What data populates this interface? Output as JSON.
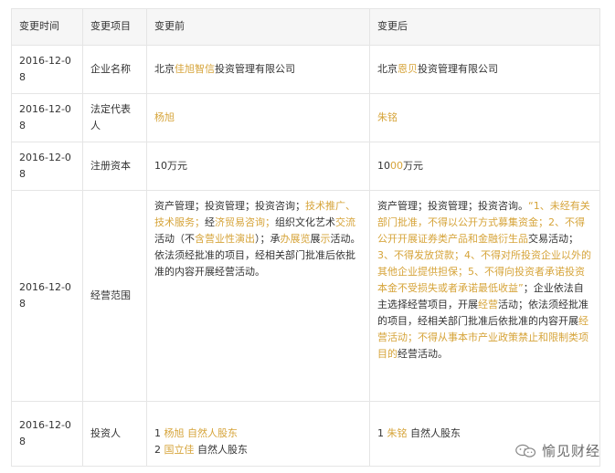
{
  "table": {
    "headers": [
      "变更时间",
      "变更项目",
      "变更前",
      "变更后"
    ],
    "rows": [
      {
        "date": "2016-12-08",
        "item": "企业名称",
        "before": [
          {
            "text": "北京"
          },
          {
            "text": "佳旭智信",
            "hl": true
          },
          {
            "text": "投资管理有限公司"
          }
        ],
        "after": [
          {
            "text": "北京"
          },
          {
            "text": "恩贝",
            "hl": true
          },
          {
            "text": "投资管理有限公司"
          }
        ]
      },
      {
        "date": "2016-12-08",
        "item": "法定代表人",
        "before": [
          {
            "text": "杨旭",
            "hl": true
          }
        ],
        "after": [
          {
            "text": "朱铭",
            "hl": true
          }
        ]
      },
      {
        "date": "2016-12-08",
        "item": "注册资本",
        "before": [
          {
            "text": "10万元"
          }
        ],
        "after": [
          {
            "text": "10"
          },
          {
            "text": "00",
            "hl": true
          },
          {
            "text": "万元"
          }
        ]
      },
      {
        "date": "2016-12-08",
        "item": "经营范围",
        "before": [
          {
            "text": "资产管理；投资管理；投资咨询；"
          },
          {
            "text": "技术推广、技术服务；",
            "hl": true
          },
          {
            "text": "经"
          },
          {
            "text": "济贸易咨询；",
            "hl": true
          },
          {
            "text": "组织文化艺术"
          },
          {
            "text": "交流",
            "hl": true
          },
          {
            "text": "活动（不"
          },
          {
            "text": "含营业性演出",
            "hl": true
          },
          {
            "text": "）；承"
          },
          {
            "text": "办展览",
            "hl": true
          },
          {
            "text": "展"
          },
          {
            "text": "示",
            "hl": true
          },
          {
            "text": "活动。依法须经批准的项目，经相关部门批准后依批准的内容开展经营活动。"
          }
        ],
        "after": [
          {
            "text": "资产管理；投资管理；投资咨询。"
          },
          {
            "text": "“1、未经有关部门批准，不得以公开方式募集资金；2、不得公开开展证券类产品和金融衍生品",
            "hl": true
          },
          {
            "text": "交易活动；"
          },
          {
            "text": "3、不得发放贷款；4、不得对所投资企业以外的其他企业提供担保；5、不得向投资者承诺投资本金不受损失或者承诺最低收益”",
            "hl": true
          },
          {
            "text": "；企业依法自主选择经营项目，开展"
          },
          {
            "text": "经营",
            "hl": true
          },
          {
            "text": "活动；依法须经批准的项目，经相关部门批准后依批准的内容开展"
          },
          {
            "text": "经营活动；不得从事本市产业政策禁止和限制类项目的",
            "hl": true
          },
          {
            "text": "经营活动。"
          }
        ]
      },
      {
        "date": "2016-12-08",
        "item": "投资人",
        "before_lines": [
          [
            {
              "text": "1 "
            },
            {
              "text": "杨旭",
              "hl": true
            },
            {
              "text": " 自然人股东",
              "hl": true
            }
          ],
          [
            {
              "text": "2 "
            },
            {
              "text": "国立佳",
              "hl": true
            },
            {
              "text": " 自然人股东"
            }
          ]
        ],
        "after_lines": [
          [
            {
              "text": "1 "
            },
            {
              "text": "朱铭",
              "hl": true
            },
            {
              "text": " 自然人股东"
            }
          ]
        ]
      }
    ]
  },
  "watermark": {
    "icon": "wechat-icon",
    "text": "愉见财经"
  },
  "colors": {
    "highlight": "#d6a43a",
    "header_bg": "#f6f6f6",
    "border": "#e5e5e5",
    "text": "#333333"
  }
}
